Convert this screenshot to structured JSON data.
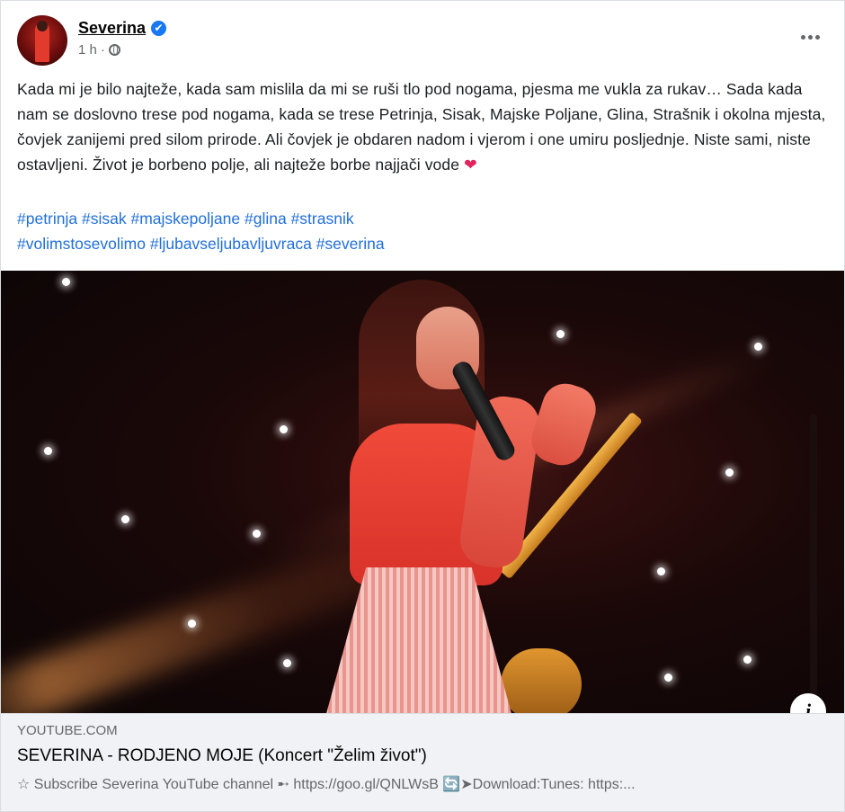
{
  "post": {
    "author": "Severina",
    "verified_mark": "✔",
    "time": "1 h",
    "separator": "·",
    "privacy_icon": "globe-icon",
    "text": "Kada mi je bilo najteže, kada sam mislila da mi se ruši tlo pod nogama, pjesma me vukla za rukav… Sada kada nam se doslovno trese pod nogama, kada se trese Petrinja, Sisak, Majske Poljane, Glina, Strašnik i okolna mjesta, čovjek zanijemi pred silom prirode. Ali čovjek je obdaren nadom i vjerom i one umiru posljednje. Niste sami, niste ostavljeni. Život je borbeno polje, ali najteže borbe najjači vode",
    "heart": "❤",
    "hashtags": [
      "#petrinja",
      "#sisak",
      "#majskepoljane",
      "#glina",
      "#strasnik",
      "#volimstosevolimo",
      "#ljubavseljubavljuvraca",
      "#severina"
    ]
  },
  "media": {
    "info_label": "i"
  },
  "link": {
    "domain": "YOUTUBE.COM",
    "title": "SEVERINA - RODJENO MOJE (Koncert \"Želim život\")",
    "description": "☆ Subscribe Severina YouTube channel ➸ https://goo.gl/QNLWsB 🔄➤Download:Tunes: https:..."
  },
  "colors": {
    "link_blue": "#216fdb",
    "verified_blue": "#1877f2",
    "meta_gray": "#65676b"
  }
}
